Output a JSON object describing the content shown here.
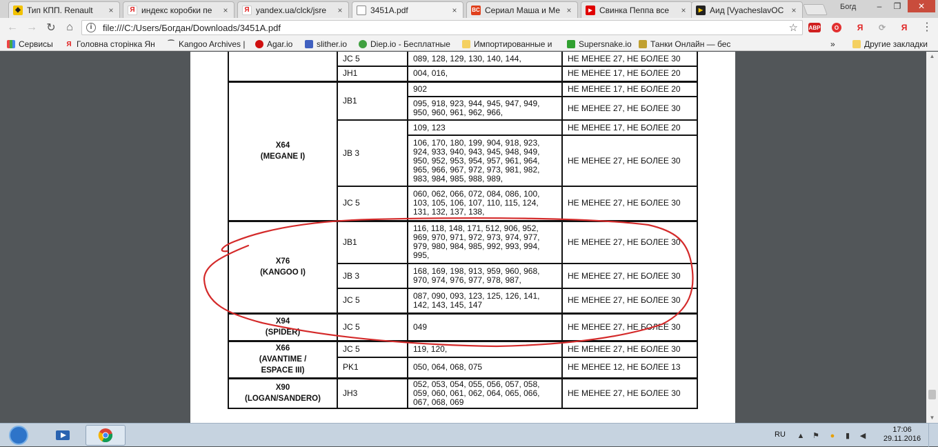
{
  "browser": {
    "tabs": [
      {
        "title": "Тип КПП.  Renault",
        "icon": "renault-logo-icon",
        "color": "#f2c200"
      },
      {
        "title": "индекс коробки пе",
        "icon": "yandex-icon",
        "color": "#e02020"
      },
      {
        "title": "yandex.ua/clck/jsre",
        "icon": "yandex-icon",
        "color": "#e02020"
      },
      {
        "title": "3451A.pdf",
        "icon": "document-icon",
        "color": "#ffffff"
      },
      {
        "title": "Сериал Маша и Ме",
        "icon": "bc-icon",
        "color": "#e0401c"
      },
      {
        "title": "Свинка Пеппа все",
        "icon": "youtube-icon",
        "color": "#e00000"
      },
      {
        "title": "Аид [VyacheslavOC",
        "icon": "play-icon",
        "color": "#333333"
      }
    ],
    "active_tab": 3,
    "user": "Богд",
    "address": "file:///C:/Users/Богдан/Downloads/3451A.pdf",
    "bookmarks": [
      {
        "label": "Сервисы",
        "icon": "apps-grid-icon"
      },
      {
        "label": "Головна сторінка Ян",
        "icon": "yandex-icon"
      },
      {
        "label": "Kangoo Archives |",
        "icon": "kangoo-icon"
      },
      {
        "label": "Agar.io",
        "icon": "agar-icon"
      },
      {
        "label": "slither.io",
        "icon": "slither-icon"
      },
      {
        "label": "Diep.io - Бесплатные",
        "icon": "diep-icon"
      },
      {
        "label": "Импортированные и",
        "icon": "folder-icon"
      },
      {
        "label": "Supersnake.io",
        "icon": "supersnake-icon"
      },
      {
        "label": "Танки Онлайн — бес",
        "icon": "tank-icon"
      }
    ],
    "bookmarks_overflow": "»",
    "other_bookmarks": "Другие закладки",
    "extensions": [
      "АВР",
      "O",
      "Я",
      "⟳",
      "Я"
    ]
  },
  "document": {
    "rows": [
      {
        "model": "",
        "box": "",
        "indices": "",
        "value": "",
        "cropped_top": true
      },
      {
        "model": "",
        "box": "JC 5",
        "indices": "089, 128, 129, 130, 140, 144,",
        "value": "НЕ МЕНЕЕ 27, НЕ БОЛЕЕ 30"
      },
      {
        "model": "",
        "box": "JH1",
        "indices": "004, 016,",
        "value": "НЕ МЕНЕЕ 17, НЕ БОЛЕЕ 20"
      },
      {
        "model": "X64\n(MEGANE I)",
        "box": "JB1",
        "indices": "902",
        "value": "НЕ МЕНЕЕ 17, НЕ БОЛЕЕ 20"
      },
      {
        "model": "",
        "box": "",
        "indices": "095, 918, 923, 944, 945, 947, 949, 950, 960, 961, 962, 966,",
        "value": "НЕ МЕНЕЕ 27, НЕ БОЛЕЕ 30"
      },
      {
        "model": "",
        "box": "JB 3",
        "indices": "109, 123",
        "value": "НЕ МЕНЕЕ 17, НЕ БОЛЕЕ 20"
      },
      {
        "model": "",
        "box": "",
        "indices": "106, 170, 180, 199, 904, 918, 923, 924, 933, 940, 943, 945, 948, 949, 950, 952, 953, 954, 957, 961, 964, 965, 966, 967, 972, 973, 981, 982, 983, 984, 985, 988, 989,",
        "value": "НЕ МЕНЕЕ 27, НЕ БОЛЕЕ 30"
      },
      {
        "model": "",
        "box": "JC 5",
        "indices": "060, 062, 066, 072, 084, 086, 100, 103, 105, 106, 107, 110, 115, 124, 131, 132, 137, 138,",
        "value": "НЕ МЕНЕЕ 27, НЕ БОЛЕЕ 30"
      },
      {
        "model": "X76\n(KANGOO I)",
        "box": "JB1",
        "indices": "116, 118, 148, 171, 512, 906, 952, 969, 970, 971, 972, 973, 974, 977, 979, 980, 984, 985, 992, 993, 994, 995,",
        "value": "НЕ МЕНЕЕ 27, НЕ БОЛЕЕ 30"
      },
      {
        "model": "",
        "box": "JB 3",
        "indices": "168, 169, 198, 913, 959, 960, 968, 970, 974, 976, 977, 978, 987,",
        "value": "НЕ МЕНЕЕ 27, НЕ БОЛЕЕ 30"
      },
      {
        "model": "",
        "box": "JC 5",
        "indices": "087, 090, 093, 123, 125, 126, 141, 142, 143, 145, 147",
        "value": "НЕ МЕНЕЕ 27, НЕ БОЛЕЕ 30"
      },
      {
        "model": "X94\n(SPIDER)",
        "box": "JC 5",
        "indices": "049",
        "value": "НЕ МЕНЕЕ 27, НЕ БОЛЕЕ 30"
      },
      {
        "model": "X66\n(AVANTIME /\nESPACE III)",
        "box": "JC 5",
        "indices": "119, 120,",
        "value": "НЕ МЕНЕЕ 27, НЕ БОЛЕЕ 30"
      },
      {
        "model": "",
        "box": "PK1",
        "indices": "050, 064, 068, 075",
        "value": "НЕ МЕНЕЕ 12, НЕ БОЛЕЕ 13"
      },
      {
        "model": "X90\n(LOGAN/SANDERO)",
        "box": "JH3",
        "indices": "052, 053, 054, 055, 056, 057, 058, 059, 060, 061, 062, 064, 065, 066, 067, 068, 069",
        "value": "НЕ МЕНЕЕ 27, НЕ БОЛЕЕ 30"
      }
    ]
  },
  "taskbar": {
    "language": "RU",
    "time": "17:06",
    "date": "29.11.2016",
    "apps": [
      "media-player-icon",
      "file-explorer-icon",
      "chrome-icon"
    ]
  }
}
